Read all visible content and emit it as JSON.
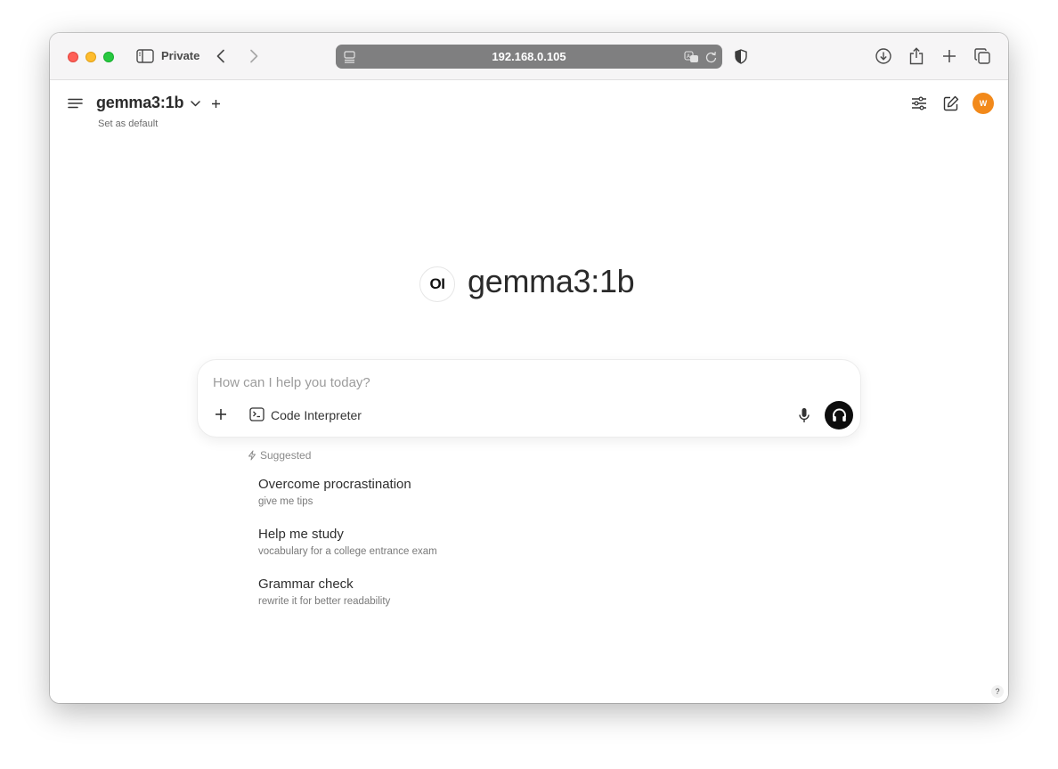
{
  "browser": {
    "private_label": "Private",
    "url": "192.168.0.105",
    "icons": [
      "sidebar-icon",
      "back-icon",
      "forward-icon",
      "page-menu-icon",
      "translate-icon",
      "reload-icon",
      "privacy-shield-icon",
      "downloads-icon",
      "share-icon",
      "new-tab-icon",
      "tab-overview-icon"
    ]
  },
  "header": {
    "model_name": "gemma3:1b",
    "set_default": "Set as default",
    "avatar_initial": "W",
    "avatar_color": "#f2891a"
  },
  "hero": {
    "logo_text": "OI",
    "title": "gemma3:1b"
  },
  "prompt": {
    "placeholder": "How can I help you today?",
    "value": "",
    "code_interpreter_label": "Code Interpreter"
  },
  "suggested": {
    "label": "Suggested",
    "items": [
      {
        "title": "Overcome procrastination",
        "subtitle": "give me tips"
      },
      {
        "title": "Help me study",
        "subtitle": "vocabulary for a college entrance exam"
      },
      {
        "title": "Grammar check",
        "subtitle": "rewrite it for better readability"
      }
    ]
  },
  "help_label": "?"
}
